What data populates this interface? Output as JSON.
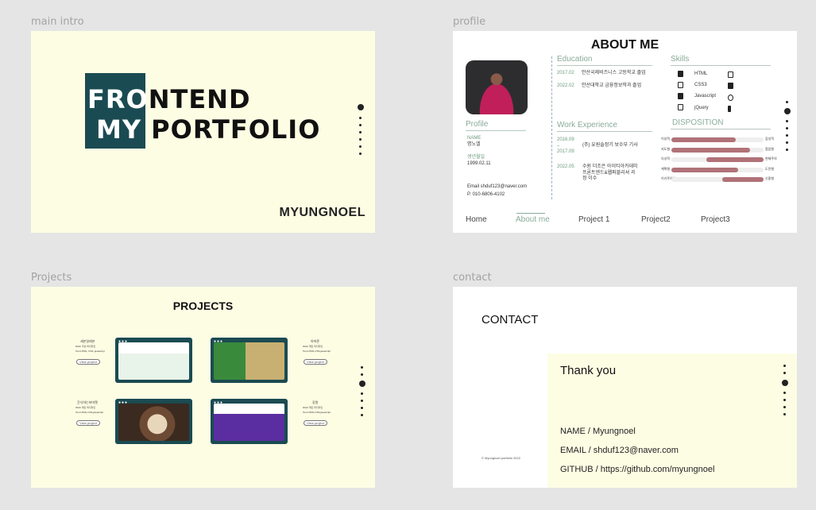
{
  "frames": {
    "intro": {
      "label": "main intro",
      "line1_a": "FRO",
      "line1_b": "NTEND",
      "line2_a": "MY",
      "line2_b": "PORTFOLIO",
      "owner": "MYUNGNOEL"
    },
    "profile": {
      "label": "profile",
      "title": "ABOUT ME",
      "profile_heading": "Profile",
      "name_label": "NAME",
      "name_value": "명노엘",
      "birth_label": "생년월일",
      "birth_value": "1999.02.11",
      "email": "Email shduf123@naver.com",
      "phone": "P.   010-6806-4102",
      "education_heading": "Education",
      "education": [
        {
          "date": "2017.02",
          "text": "안산국제비즈니스 고등학교 졸업"
        },
        {
          "date": "2022.02",
          "text": "안산대학교 금융정보학과 졸업"
        }
      ],
      "work_heading": "Work Experience",
      "work": [
        {
          "date": "2016.09\n–\n2017.09",
          "text": "(주) 유원솔정기 보수부 기사"
        },
        {
          "date": "2022.05",
          "text": "수원 더조은 아이티아카데미 프론트엔드&웹퍼블리셔 과정 이수"
        }
      ],
      "skills_heading": "Skills",
      "skills": [
        {
          "icon": "html-file-icon",
          "name": "HTML",
          "icon2": "bracket-icon"
        },
        {
          "icon": "css-file-icon",
          "name": "CSS3",
          "icon2": "figma-icon"
        },
        {
          "icon": "js-file-icon",
          "name": "Javascript",
          "icon2": "github-icon"
        },
        {
          "icon": "jquery-icon",
          "name": "jQuery",
          "icon2": "photoshop-icon"
        }
      ],
      "disposition_heading": "DISPOSITION",
      "disposition": [
        {
          "left": "이성적",
          "right": "감성적",
          "start": 0.0,
          "end": 0.7
        },
        {
          "left": "지도형",
          "right": "협업형",
          "start": 0.0,
          "end": 0.85
        },
        {
          "left": "다성적",
          "right": "현재주의",
          "start": 0.38,
          "end": 1.0
        },
        {
          "left": "계획형",
          "right": "도전형",
          "start": 0.0,
          "end": 0.72
        },
        {
          "left": "이기주의형",
          "right": "신중형",
          "start": 0.55,
          "end": 1.0
        }
      ],
      "nav": [
        "Home",
        "About me",
        "Project 1",
        "Project2",
        "Project3"
      ],
      "active_nav": "About me"
    },
    "projects": {
      "label": "Projects",
      "title": "PROJECTS",
      "button_label": "View project",
      "items": [
        {
          "name": "세븐일레븐",
          "l1": "Work 가상 리디자인",
          "l2": "Tool HTML, CSS, javascript"
        },
        {
          "name": "아마존",
          "l1": "Work 개인 리디자인",
          "l2": "Tool HTML,CSS,javascript"
        },
        {
          "name": "간식하는보마켓",
          "l1": "Work 개인 리디자인",
          "l2": "Tool HTML,CSS,javascript"
        },
        {
          "name": "강원",
          "l1": "Work 개인 리디자인",
          "l2": "Tool HTML,CSS,javascript"
        }
      ]
    },
    "contact": {
      "label": "contact",
      "title": "CONTACT",
      "thanks": "Thank you",
      "name_line": "NAME / Myungnoel",
      "email_line": "EMAIL / shduf123@naver.com",
      "github_line": "GITHUB / https://github.com/myungnoel",
      "copyright": "© Myungnoel portfolio 2022"
    }
  },
  "colors": {
    "canvas": "#e5e5e5",
    "cream": "#fdfde4",
    "teal": "#1b4b52",
    "sage": "#8aab9a",
    "bar": "#b07278"
  }
}
